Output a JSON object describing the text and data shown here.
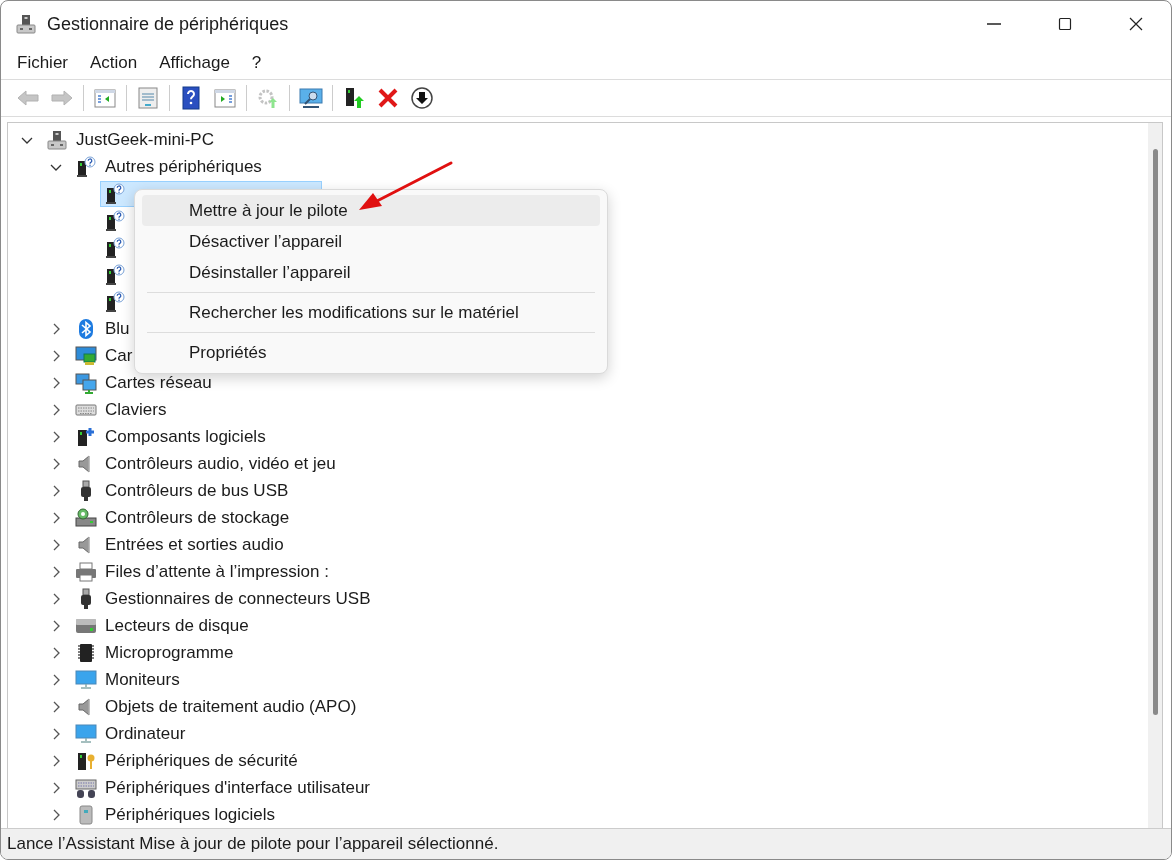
{
  "window": {
    "title": "Gestionnaire de périphériques"
  },
  "menu_bar": [
    {
      "label": "Fichier"
    },
    {
      "label": "Action"
    },
    {
      "label": "Affichage"
    },
    {
      "label": "?"
    }
  ],
  "toolbar": [
    [
      {
        "kind": "back",
        "disabled": true
      },
      {
        "kind": "forward",
        "disabled": true
      }
    ],
    [
      {
        "kind": "tree-pane",
        "disabled": false
      }
    ],
    [
      {
        "kind": "properties",
        "disabled": false
      }
    ],
    [
      {
        "kind": "help",
        "disabled": false
      },
      {
        "kind": "action-pane",
        "disabled": false
      }
    ],
    [
      {
        "kind": "update-driver",
        "disabled": true
      }
    ],
    [
      {
        "kind": "scan",
        "disabled": false
      }
    ],
    [
      {
        "kind": "enable",
        "disabled": false
      },
      {
        "kind": "uninstall",
        "disabled": false
      },
      {
        "kind": "disable",
        "disabled": false
      }
    ]
  ],
  "tree": [
    {
      "label": "JustGeek-mini-PC",
      "kind": "computer",
      "expanded": true,
      "selected": false,
      "children": [
        {
          "label": "Autres périphériques",
          "kind": "unknown",
          "expanded": true,
          "selected": false,
          "children": [
            {
              "kind": "unknown",
              "selected": true
            },
            {
              "kind": "unknown",
              "selected": false
            },
            {
              "kind": "unknown",
              "selected": false
            },
            {
              "kind": "unknown",
              "selected": false
            },
            {
              "kind": "unknown",
              "selected": false
            }
          ]
        },
        {
          "label": "Blu",
          "kind": "bluetooth",
          "expanded": false,
          "selected": false
        },
        {
          "label": "Car",
          "kind": "display",
          "expanded": false,
          "selected": false
        },
        {
          "label": "Cartes réseau",
          "kind": "network",
          "expanded": false,
          "selected": false
        },
        {
          "label": "Claviers",
          "kind": "keyboard",
          "expanded": false,
          "selected": false
        },
        {
          "label": "Composants logiciels",
          "kind": "component",
          "expanded": false,
          "selected": false
        },
        {
          "label": "Contrôleurs audio, vidéo et jeu",
          "kind": "audio",
          "expanded": false,
          "selected": false
        },
        {
          "label": "Contrôleurs de bus USB",
          "kind": "usb",
          "expanded": false,
          "selected": false
        },
        {
          "label": "Contrôleurs de stockage",
          "kind": "storage",
          "expanded": false,
          "selected": false
        },
        {
          "label": "Entrées et sorties audio",
          "kind": "audio",
          "expanded": false,
          "selected": false
        },
        {
          "label": "Files d’attente à l’impression :",
          "kind": "printer",
          "expanded": false,
          "selected": false
        },
        {
          "label": "Gestionnaires de connecteurs USB",
          "kind": "usb",
          "expanded": false,
          "selected": false
        },
        {
          "label": "Lecteurs de disque",
          "kind": "disk",
          "expanded": false,
          "selected": false
        },
        {
          "label": "Microprogramme",
          "kind": "chip",
          "expanded": false,
          "selected": false
        },
        {
          "label": "Moniteurs",
          "kind": "monitor",
          "expanded": false,
          "selected": false
        },
        {
          "label": "Objets de traitement audio (APO)",
          "kind": "audio",
          "expanded": false,
          "selected": false
        },
        {
          "label": "Ordinateur",
          "kind": "monitor",
          "expanded": false,
          "selected": false
        },
        {
          "label": "Périphériques de sécurité",
          "kind": "security",
          "expanded": false,
          "selected": false
        },
        {
          "label": "Périphériques d'interface utilisateur",
          "kind": "hid",
          "expanded": false,
          "selected": false
        },
        {
          "label": "Périphériques logiciels",
          "kind": "software",
          "expanded": false,
          "selected": false
        }
      ]
    }
  ],
  "context_menu": {
    "groups": [
      [
        {
          "label": "Mettre à jour le pilote",
          "selected": true
        },
        {
          "label": "Désactiver l’appareil",
          "selected": false
        },
        {
          "label": "Désinstaller l’appareil",
          "selected": false
        }
      ],
      [
        {
          "label": "Rechercher les modifications sur le matériel",
          "selected": false
        }
      ],
      [
        {
          "label": "Propriétés",
          "selected": false
        }
      ]
    ]
  },
  "status_bar": {
    "text": "Lance l’Assistant Mise à jour de pilote pour l’appareil sélectionné."
  }
}
